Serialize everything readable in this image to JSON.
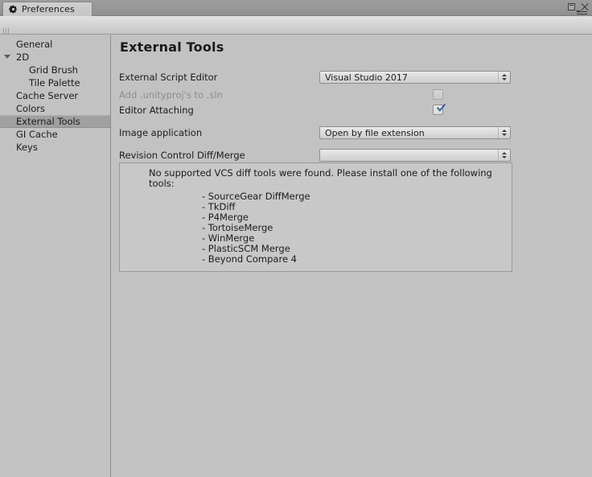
{
  "window": {
    "tab_label": "Preferences",
    "tab_icon": "gear-icon",
    "controls": {
      "maximize": "maximize-icon",
      "close": "close-icon",
      "menu": "window-menu-icon"
    }
  },
  "toolbar": {
    "search": {
      "icon": "search-icon",
      "value": "",
      "placeholder": ""
    }
  },
  "sidebar": {
    "items": [
      {
        "label": "General",
        "indent": 0,
        "selected": false,
        "foldout": ""
      },
      {
        "label": "2D",
        "indent": 0,
        "selected": false,
        "foldout": "expanded"
      },
      {
        "label": "Grid Brush",
        "indent": 1,
        "selected": false,
        "foldout": ""
      },
      {
        "label": "Tile Palette",
        "indent": 1,
        "selected": false,
        "foldout": ""
      },
      {
        "label": "Cache Server",
        "indent": 0,
        "selected": false,
        "foldout": ""
      },
      {
        "label": "Colors",
        "indent": 0,
        "selected": false,
        "foldout": ""
      },
      {
        "label": "External Tools",
        "indent": 0,
        "selected": true,
        "foldout": ""
      },
      {
        "label": "GI Cache",
        "indent": 0,
        "selected": false,
        "foldout": ""
      },
      {
        "label": "Keys",
        "indent": 0,
        "selected": false,
        "foldout": ""
      }
    ]
  },
  "main": {
    "title": "External Tools",
    "fields": {
      "external_script_editor": {
        "label": "External Script Editor",
        "value": "Visual Studio 2017"
      },
      "add_unityproj": {
        "label": "Add .unityproj's to .sln",
        "checked": false,
        "disabled": true
      },
      "editor_attaching": {
        "label": "Editor Attaching",
        "checked": true,
        "disabled": false
      },
      "image_application": {
        "label": "Image application",
        "value": "Open by file extension"
      },
      "revision_control": {
        "label": "Revision Control Diff/Merge",
        "value": ""
      }
    },
    "helpbox": {
      "message": "No supported VCS diff tools were found. Please install one of the following tools:",
      "tools": [
        "- SourceGear DiffMerge",
        "- TkDiff",
        "- P4Merge",
        "- TortoiseMerge",
        "- WinMerge",
        "- PlasticSCM Merge",
        "- Beyond Compare 4"
      ]
    }
  },
  "colors": {
    "window_bg": "#c2c2c2",
    "titlebar": "#979797",
    "selection": "#a0a0a0",
    "checkbox_accent": "#2a5fa8",
    "disabled_text": "#8d8d8d",
    "helpbox_bg": "#c8c8c8"
  }
}
